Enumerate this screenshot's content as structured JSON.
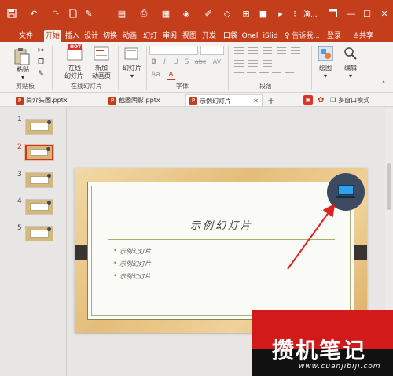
{
  "titlebar": {
    "title": "演...",
    "quick_access": [
      "save-icon",
      "undo-icon",
      "redo-icon",
      "new-file-icon",
      "format-painter-icon",
      "print-icon",
      "paste-icon",
      "brush-icon",
      "shape-icon",
      "table-icon",
      "color-icon",
      "more-icon"
    ],
    "window_controls": [
      "restore-icon",
      "minimize-icon",
      "maximize-icon",
      "close-icon"
    ]
  },
  "ribbon_tabs": [
    "文件",
    "开始",
    "插入",
    "设计",
    "切换",
    "动画",
    "幻灯",
    "审阅",
    "视图",
    "开发",
    "口袋",
    "Onel",
    "iSlid",
    "告诉我...",
    "登录",
    "共享"
  ],
  "active_tab": "开始",
  "ribbon": {
    "clipboard": {
      "paste": "粘贴",
      "label": "剪贴板"
    },
    "online_slides": {
      "online": "在线",
      "online2": "幻灯片",
      "new": "新加",
      "new2": "动画页",
      "hot": "HOT",
      "label": "在线幻灯片"
    },
    "slides": {
      "button": "幻灯片"
    },
    "font": {
      "label": "字体",
      "buttons": [
        "B",
        "I",
        "U",
        "S",
        "abc",
        "AV",
        "Aa",
        "A"
      ]
    },
    "paragraph": {
      "label": "段落"
    },
    "drawing": {
      "button": "绘图"
    },
    "editing": {
      "button": "编辑"
    }
  },
  "doc_tabs": [
    {
      "label": "简介头图.pptx",
      "active": false
    },
    {
      "label": "截图阴影.pptx",
      "active": false
    },
    {
      "label": "示例幻灯片",
      "active": true
    }
  ],
  "doc_tab_extras": {
    "window_mode": "多窗口模式"
  },
  "thumbnails": [
    {
      "number": "1",
      "selected": false
    },
    {
      "number": "2",
      "selected": true
    },
    {
      "number": "3",
      "selected": false
    },
    {
      "number": "4",
      "selected": false
    },
    {
      "number": "5",
      "selected": false
    }
  ],
  "slide": {
    "title": "示例幻灯片",
    "bullets": [
      "示例幻灯片",
      "示例幻灯片",
      "示例幻灯片"
    ],
    "badge_icon": "laptop-icon"
  },
  "watermark": {
    "text": "攒机笔记",
    "url": "www.cuanjibiji.com"
  },
  "colors": {
    "accent": "#c43e1c",
    "badge": "#3b4a60",
    "arrow": "#e02020"
  }
}
